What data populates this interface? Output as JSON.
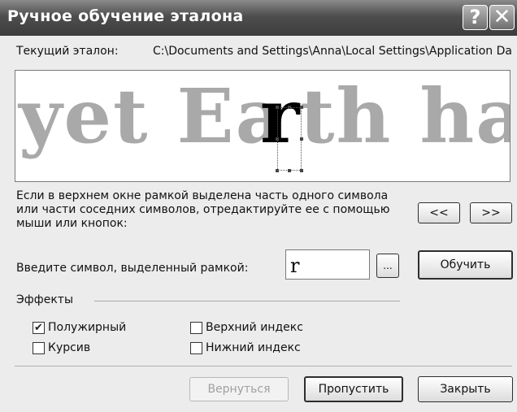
{
  "window": {
    "title": "Ручное обучение эталона",
    "help_glyph": "?",
    "close_glyph": "✕"
  },
  "current": {
    "label": "Текущий эталон:",
    "path": "C:\\Documents and Settings\\Anna\\Local Settings\\Application Dat"
  },
  "preview": {
    "before": "yet Ea",
    "highlight": "r",
    "after": "th has"
  },
  "hint": {
    "text": "Если в верхнем окне рамкой выделена часть одного символа или части соседних символов, отредактируйте ее с помощью мыши или кнопок:"
  },
  "nav": {
    "prev_label": "<<",
    "next_label": ">>"
  },
  "input": {
    "label": "Введите символ, выделенный рамкой:",
    "value": "r",
    "browse_label": "...",
    "train_label": "Обучить"
  },
  "effects": {
    "title": "Эффекты",
    "bold": {
      "label": "Полужирный",
      "checked": true
    },
    "italic": {
      "label": "Курсив",
      "checked": false
    },
    "superscript": {
      "label": "Верхний индекс",
      "checked": false
    },
    "subscript": {
      "label": "Нижний индекс",
      "checked": false
    }
  },
  "footer": {
    "back_label": "Вернуться",
    "skip_label": "Пропустить",
    "close_label": "Закрыть"
  },
  "colors": {
    "titlebar": "#4e4e4e",
    "preview_text": "#a9a9a9",
    "highlight_text": "#000000"
  }
}
